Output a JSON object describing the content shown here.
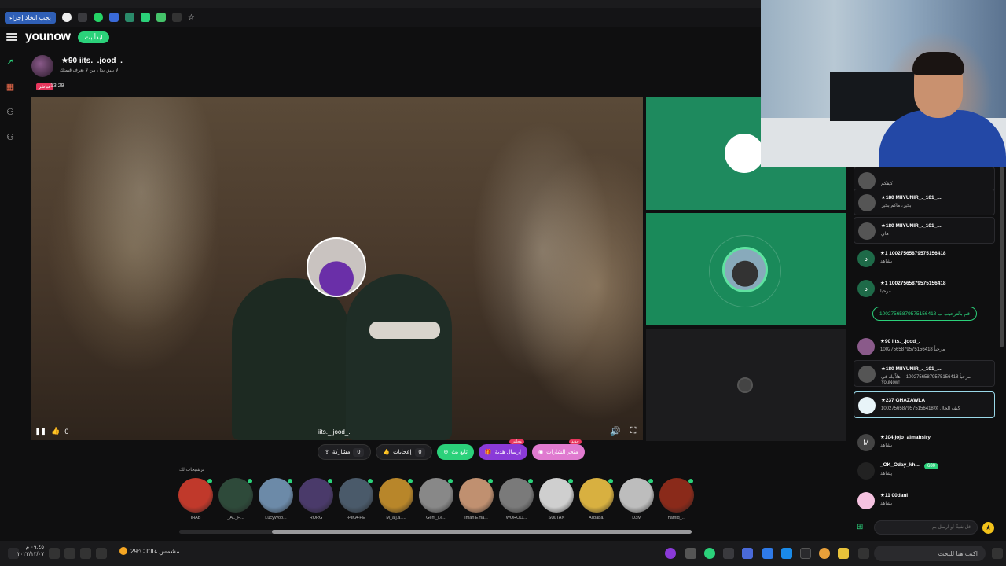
{
  "browser": {
    "bookmark_button": "يجب اتخاذ إجراء"
  },
  "header": {
    "logo": "younow",
    "go_live": "ابدأ بث"
  },
  "broadcaster": {
    "name": "★90 iits._.jood_.",
    "description": "لا يليق بدا ، من لا يعرف قيمتك",
    "live_badge": "مباشر",
    "live_time": "13:29",
    "video_username": "iits._.jood_.",
    "likes": "0"
  },
  "actions": {
    "share_label": "مشاركة",
    "share_count": "0",
    "likes_label": "إعجابات",
    "likes_count": "0",
    "follow_label": "تابع بث",
    "gift_label": "إرسال هدية",
    "gift_tag": "مجاني",
    "subscribe_label": "متجر الشارات",
    "subscribe_tag": "جديد"
  },
  "recommended": {
    "title": "ترشيحات لك",
    "items": [
      {
        "name": "IHAB",
        "color": "#c0392b"
      },
      {
        "name": "_AL_H...",
        "color": "#2e4a3a"
      },
      {
        "name": "LucyWoo...",
        "color": "#6c8aa8"
      },
      {
        "name": "RORG",
        "color": "#4a3a6a"
      },
      {
        "name": "-PIKA-PE",
        "color": "#4a5a6a"
      },
      {
        "name": "M_a.j.a.l...",
        "color": "#b8862a"
      },
      {
        "name": "Gent_Le...",
        "color": "#888"
      },
      {
        "name": "Iman Ema...",
        "color": "#c09070"
      },
      {
        "name": "WOROO...",
        "color": "#7a7a7a"
      },
      {
        "name": "SULTAN",
        "color": "#cfcfcf"
      },
      {
        "name": "Allbaba.",
        "color": "#d8b040"
      },
      {
        "name": "D3M",
        "color": "#bdbdbd"
      },
      {
        "name": "hamid_...",
        "color": "#8a2a1a"
      }
    ]
  },
  "chat": {
    "messages": [
      {
        "top": "",
        "sub": "كيفكم",
        "boxed": true,
        "color": "#555"
      },
      {
        "top": "★180 MIIYUNIR_._101_...",
        "sub": "بخير، ماكم بخير",
        "boxed": true,
        "color": "#555"
      },
      {
        "top": "★180 MIIYUNIR_._101_...",
        "sub": "هاي",
        "boxed": true,
        "color": "#555"
      },
      {
        "top": "★1 1002756587957515641​8",
        "sub": "يشاهد",
        "boxed": false,
        "color": "#1e6a48",
        "letter": "د"
      },
      {
        "top": "★1 10027565879575156418",
        "sub": "مرحبا",
        "boxed": false,
        "color": "#1e6a48",
        "letter": "د"
      },
      {
        "top": "★90 iits._.jood_.",
        "sub": "10027565879575156418 مرحباً",
        "boxed": false,
        "color": "#8a5a8a"
      },
      {
        "top": "★180 MIIYUNIR_._101_...",
        "sub": "مرحباً 10027565879575156418 - أهلاً بك في",
        "sub2": "YouNow!",
        "boxed": true,
        "color": "#555"
      },
      {
        "top": "★237 GHAZAWLA",
        "sub": "10027565879575156418@ كيف الحال",
        "boxed": true,
        "color": "#e8f4f8"
      },
      {
        "top": "★104 jojo_almahsiry",
        "sub": "يشاهد",
        "boxed": false,
        "color": "#444",
        "letter": "M"
      },
      {
        "top": "_OK_Oday_kh...",
        "sub": "يشاهد",
        "boxed": false,
        "color": "#222"
      },
      {
        "top": "★11 00dani",
        "sub": "يشاهد",
        "boxed": false,
        "color": "#f5c2e0"
      }
    ],
    "welcome": "قم بالترحيب ب 10027565879575156418",
    "badge_count": "680",
    "input_placeholder": "قل شيئًا أو ارسل بم"
  },
  "taskbar": {
    "time": "٠٩:٤٥ م",
    "date": "٢٠٢٣/١٢/٠٧",
    "weather": "29°C  مشمس غالبًا",
    "search_placeholder": "اكتب هنا للبحث"
  },
  "colors": {
    "accent_green": "#2bd17a",
    "live_red": "#e8365d",
    "gift_purple": "#8a3ad8"
  }
}
